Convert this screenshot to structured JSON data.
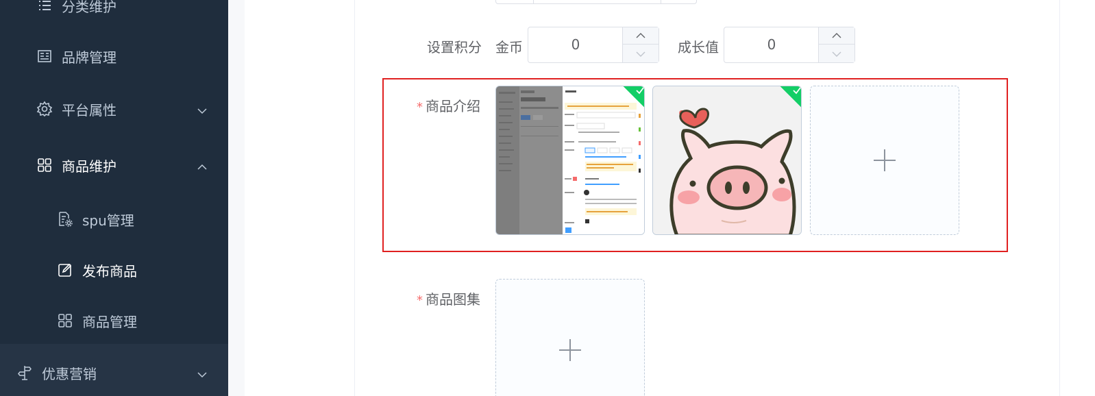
{
  "sidebar": {
    "items": [
      {
        "label": "分类维护",
        "icon": "list-icon"
      },
      {
        "label": "品牌管理",
        "icon": "brand-icon"
      },
      {
        "label": "平台属性",
        "icon": "gear-icon"
      },
      {
        "label": "商品维护",
        "icon": "grid-icon"
      },
      {
        "label": "spu管理",
        "icon": "doc-gear-icon"
      },
      {
        "label": "发布商品",
        "icon": "edit-icon"
      },
      {
        "label": "商品管理",
        "icon": "grid-icon"
      },
      {
        "label": "优惠营销",
        "icon": "signpost-icon"
      }
    ]
  },
  "form": {
    "points": {
      "label": "设置积分",
      "coin_label": "金币",
      "coin_value": "0",
      "growth_label": "成长值",
      "growth_value": "0"
    },
    "intro": {
      "required_mark": "*",
      "label": "商品介绍"
    },
    "gallery": {
      "required_mark": "*",
      "label": "商品图集"
    }
  },
  "colors": {
    "sidebar_bg": "#1f2d3d",
    "sidebar_text": "#bfcbd9",
    "success_green": "#13ce66",
    "highlight_red": "#e02020",
    "required_red": "#f56c6c"
  }
}
